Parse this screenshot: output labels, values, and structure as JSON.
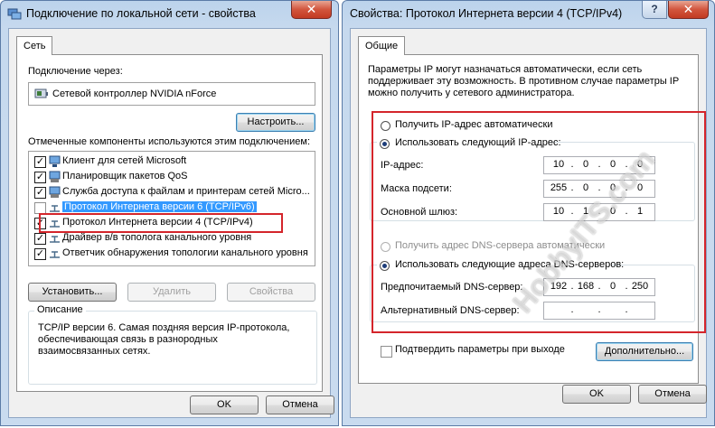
{
  "left_window": {
    "title": "Подключение по локальной сети - свойства",
    "close_symbol": "✕",
    "tab": "Сеть",
    "connect_via_label": "Подключение через:",
    "adapter_name": "Сетевой контроллер NVIDIA nForce",
    "configure_button": "Настроить...",
    "components_label": "Отмеченные компоненты используются этим подключением:",
    "components": [
      {
        "label": "Клиент для сетей Microsoft",
        "checked": true,
        "icon": "network-client-icon"
      },
      {
        "label": "Планировщик пакетов QoS",
        "checked": true,
        "icon": "network-service-icon"
      },
      {
        "label": "Служба доступа к файлам и принтерам сетей Micro...",
        "checked": true,
        "icon": "network-service-icon"
      },
      {
        "label": "Протокол Интернета версии 6 (TCP/IPv6)",
        "checked": false,
        "icon": "protocol-icon",
        "selected": true
      },
      {
        "label": "Протокол Интернета версии 4 (TCP/IPv4)",
        "checked": true,
        "icon": "protocol-icon",
        "highlighted": true
      },
      {
        "label": "Драйвер в/в тополога канального уровня",
        "checked": true,
        "icon": "protocol-icon"
      },
      {
        "label": "Ответчик обнаружения топологии канального уровня",
        "checked": true,
        "icon": "protocol-icon"
      }
    ],
    "install_button": "Установить...",
    "remove_button": "Удалить",
    "properties_button": "Свойства",
    "description_group": "Описание",
    "description_text": "TCP/IP версии 6. Самая поздняя версия IP-протокола, обеспечивающая связь в разнородных взаимосвязанных сетях.",
    "ok_button": "OK",
    "cancel_button": "Отмена"
  },
  "right_window": {
    "title": "Свойства: Протокол Интернета версии 4 (TCP/IPv4)",
    "help_symbol": "?",
    "close_symbol": "✕",
    "tab": "Общие",
    "intro_text": "Параметры IP могут назначаться автоматически, если сеть поддерживает эту возможность. В противном случае параметры IP можно получить у сетевого администратора.",
    "ip_auto_radio": "Получить IP-адрес автоматически",
    "ip_manual_radio": "Использовать следующий IP-адрес:",
    "ip_mode": "manual",
    "ip_address_label": "IP-адрес:",
    "ip_address": [
      "10",
      "0",
      "0",
      "0"
    ],
    "subnet_label": "Маска подсети:",
    "subnet": [
      "255",
      "0",
      "0",
      "0"
    ],
    "gateway_label": "Основной шлюз:",
    "gateway": [
      "10",
      "1",
      "0",
      "1"
    ],
    "dns_auto_radio": "Получить адрес DNS-сервера автоматически",
    "dns_manual_radio": "Использовать следующие адреса DNS-серверов:",
    "dns_mode": "manual",
    "preferred_dns_label": "Предпочитаемый DNS-сервер:",
    "preferred_dns": [
      "192",
      "168",
      "0",
      "250"
    ],
    "alternate_dns_label": "Альтернативный DNS-сервер:",
    "alternate_dns": [
      "",
      "",
      "",
      ""
    ],
    "validate_checkbox": "Подтвердить параметры при выходе",
    "validate_checked": false,
    "advanced_button": "Дополнительно...",
    "ok_button": "OK",
    "cancel_button": "Отмена"
  },
  "watermark": "HobbyITS.com",
  "colors": {
    "highlight_red": "#d4252b",
    "selection_blue": "#3399ff"
  }
}
